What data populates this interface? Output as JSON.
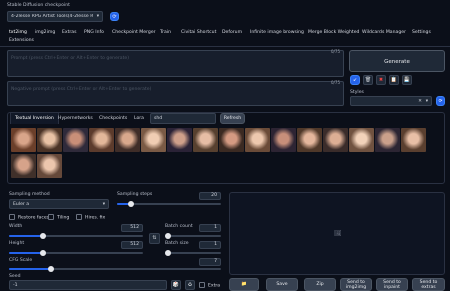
{
  "checkpoint": {
    "label": "Stable Diffusion checkpoint",
    "value": "4-2lesse RPG Artist Tools(4-2lesse RPG Artist Too"
  },
  "main_tabs": [
    "txt2img",
    "img2img",
    "Extras",
    "PNG Info",
    "Checkpoint Merger",
    "Train",
    "Civitai Shortcut",
    "Deforum",
    "Infinite image browsing",
    "Merge Block Weighted",
    "Wildcards Manager",
    "Settings"
  ],
  "sub_tab": "Extensions",
  "prompt": {
    "placeholder": "Prompt (press Ctrl+Enter or Alt+Enter to generate)",
    "counter": "0/75"
  },
  "negative_prompt": {
    "placeholder": "Negative prompt (press Ctrl+Enter or Alt+Enter to generate)",
    "counter": "0/75"
  },
  "generate_label": "Generate",
  "styles": {
    "label": "Styles"
  },
  "extra_networks": {
    "tabs": [
      "Textual Inversion",
      "Hypernetworks",
      "Checkpoints",
      "Lora"
    ],
    "search_value": "shd",
    "refresh_label": "Refresh"
  },
  "sampling": {
    "method_label": "Sampling method",
    "method_value": "Euler a",
    "steps_label": "Sampling steps",
    "steps_value": "20",
    "steps_fraction": 0.13
  },
  "options": {
    "restore_faces": "Restore faces",
    "tiling": "Tiling",
    "hires_fix": "Hires. fix"
  },
  "width": {
    "label": "Width",
    "value": "512",
    "fraction": 0.25
  },
  "height": {
    "label": "Height",
    "value": "512",
    "fraction": 0.25
  },
  "batch_count": {
    "label": "Batch count",
    "value": "1",
    "fraction": 0.0
  },
  "batch_size": {
    "label": "Batch size",
    "value": "1",
    "fraction": 0.0
  },
  "cfg": {
    "label": "CFG Scale",
    "value": "7",
    "fraction": 0.2
  },
  "seed": {
    "label": "Seed",
    "value": "-1",
    "extra_label": "Extra"
  },
  "output_buttons": [
    "Save",
    "Zip",
    "Send to img2img",
    "Send to inpaint",
    "Send to extras"
  ],
  "colors": {
    "accent": "#2563eb",
    "background": "#0b0f19"
  }
}
